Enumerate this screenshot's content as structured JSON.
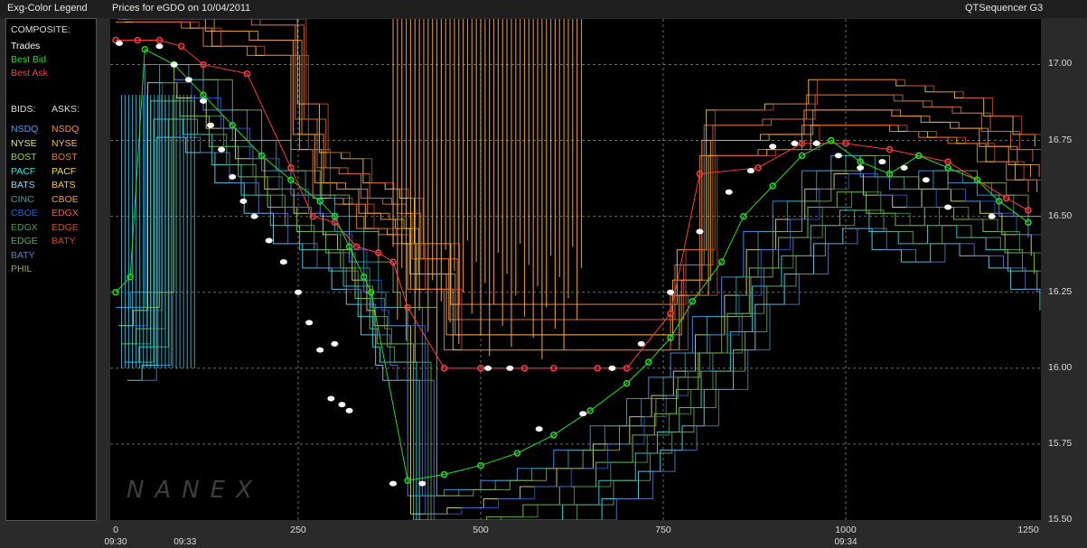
{
  "header": {
    "legend_title": "Exg-Color Legend",
    "chart_title": "Prices for  eGDO  on  10/04/2011",
    "app_name": "QTSequencer G3"
  },
  "legend": {
    "composite_header": "COMPOSITE:",
    "composite": [
      {
        "label": "Trades",
        "color": "#ffffff"
      },
      {
        "label": "Best Bid",
        "color": "#22dd22"
      },
      {
        "label": "Best Ask",
        "color": "#ff3b3b"
      }
    ],
    "bids_header": "BIDS:",
    "asks_header": "ASKS:",
    "bids": [
      {
        "label": "NSDQ",
        "color": "#4aa0ff"
      },
      {
        "label": "NYSE",
        "color": "#e8e87a"
      },
      {
        "label": "BOST",
        "color": "#8ed64a"
      },
      {
        "label": "PACF",
        "color": "#2ee6e6"
      },
      {
        "label": "BATS",
        "color": "#6fe0ff"
      },
      {
        "label": "CINC",
        "color": "#3aa6a6"
      },
      {
        "label": "CBOE",
        "color": "#2b5fd0"
      },
      {
        "label": "EDGX",
        "color": "#4f9a4f"
      },
      {
        "label": "EDGE",
        "color": "#6aa66a"
      },
      {
        "label": "BATY",
        "color": "#5a7cc8"
      },
      {
        "label": "PHIL",
        "color": "#8fae5a"
      }
    ],
    "asks": [
      {
        "label": "NSDQ",
        "color": "#ff8c3a"
      },
      {
        "label": "NYSE",
        "color": "#ffb26a"
      },
      {
        "label": "BOST",
        "color": "#d87a4a"
      },
      {
        "label": "PACF",
        "color": "#ffd84a"
      },
      {
        "label": "BATS",
        "color": "#ffc23a"
      },
      {
        "label": "CBOE",
        "color": "#e6a23a"
      },
      {
        "label": "EDGX",
        "color": "#d86a3a"
      },
      {
        "label": "EDGE",
        "color": "#c8502a"
      },
      {
        "label": "BATY",
        "color": "#c84a2a"
      }
    ]
  },
  "chart_data": {
    "type": "line",
    "title": "Prices for  eGDO  on  10/04/2011",
    "xlim": [
      0,
      1250
    ],
    "ylim": [
      15.5,
      17.15
    ],
    "x_ticks": [
      "0",
      "250",
      "500",
      "750",
      "1000",
      "1250"
    ],
    "x_tick_values": [
      0,
      250,
      500,
      750,
      1000,
      1250
    ],
    "time_labels": [
      {
        "x": 0,
        "label": "09:30"
      },
      {
        "x": 95,
        "label": "09:33"
      },
      {
        "x": 1000,
        "label": "09:34"
      }
    ],
    "y_ticks": [
      "15.50",
      "15.75",
      "16.00",
      "16.25",
      "16.50",
      "16.75",
      "17.00"
    ],
    "y_tick_values": [
      15.5,
      15.75,
      16.0,
      16.25,
      16.5,
      16.75,
      17.0
    ],
    "grid": true,
    "watermark": "NANEX",
    "series": [
      {
        "name": "Trades",
        "color": "#ffffff",
        "x": [
          5,
          60,
          80,
          100,
          120,
          130,
          145,
          160,
          175,
          190,
          210,
          230,
          250,
          265,
          280,
          295,
          300,
          310,
          320,
          380,
          420,
          510,
          540,
          580,
          640,
          680,
          720,
          760,
          800,
          840,
          870,
          900,
          930,
          960,
          990,
          1020,
          1050,
          1080,
          1110,
          1140,
          1200
        ],
        "y": [
          17.07,
          17.06,
          17.0,
          16.95,
          16.88,
          16.8,
          16.72,
          16.63,
          16.55,
          16.5,
          16.42,
          16.35,
          16.25,
          16.15,
          16.06,
          15.9,
          16.08,
          15.88,
          15.86,
          15.62,
          15.62,
          16.0,
          16.0,
          15.8,
          15.85,
          16.0,
          16.08,
          16.25,
          16.45,
          16.58,
          16.65,
          16.73,
          16.74,
          16.74,
          16.7,
          16.66,
          16.68,
          16.66,
          16.62,
          16.53,
          16.5
        ]
      },
      {
        "name": "Best Bid",
        "color": "#22dd22",
        "x": [
          0,
          20,
          40,
          80,
          120,
          160,
          200,
          240,
          280,
          300,
          320,
          340,
          350,
          400,
          450,
          500,
          550,
          600,
          650,
          700,
          730,
          760,
          790,
          830,
          860,
          900,
          940,
          980,
          1020,
          1060,
          1100,
          1140,
          1180,
          1210,
          1250
        ],
        "y": [
          16.25,
          16.3,
          17.05,
          17.0,
          16.9,
          16.8,
          16.7,
          16.62,
          16.55,
          16.5,
          16.4,
          16.3,
          16.25,
          15.63,
          15.65,
          15.68,
          15.72,
          15.78,
          15.86,
          15.95,
          16.02,
          16.1,
          16.22,
          16.35,
          16.5,
          16.6,
          16.7,
          16.75,
          16.68,
          16.64,
          16.7,
          16.66,
          16.62,
          16.55,
          16.48
        ]
      },
      {
        "name": "Best Ask",
        "color": "#ff3b3b",
        "x": [
          0,
          30,
          60,
          90,
          120,
          180,
          240,
          270,
          300,
          330,
          360,
          380,
          400,
          450,
          500,
          560,
          600,
          660,
          700,
          760,
          800,
          880,
          940,
          1000,
          1060,
          1100,
          1140,
          1180,
          1220,
          1250
        ],
        "y": [
          17.08,
          17.08,
          17.08,
          17.06,
          17.0,
          16.97,
          16.66,
          16.5,
          16.48,
          16.4,
          16.38,
          16.35,
          16.2,
          16.0,
          16.0,
          16.0,
          16.0,
          16.0,
          16.0,
          16.18,
          16.64,
          16.66,
          16.74,
          16.74,
          16.72,
          16.7,
          16.68,
          16.62,
          16.56,
          16.52
        ]
      }
    ]
  }
}
